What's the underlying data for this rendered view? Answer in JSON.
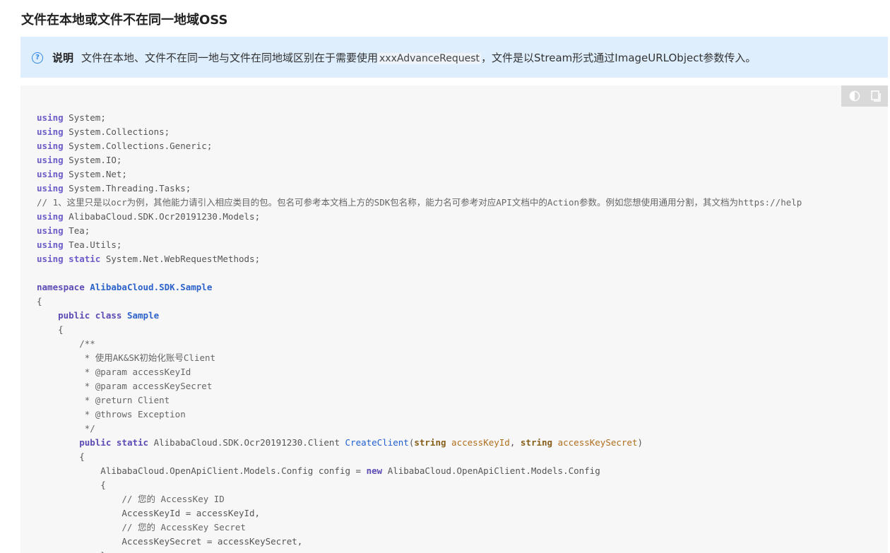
{
  "heading": "文件在本地或文件不在同一地域OSS",
  "note": {
    "icon": "question-circle-icon",
    "title": "说明",
    "text_before": "文件在本地、文件不在同一地与文件在同地域区别在于需要使用",
    "code": "xxxAdvanceRequest",
    "text_after": "，文件是以Stream形式通过ImageURLObject参数传入。"
  },
  "code_toolbar": {
    "theme_icon": "theme-toggle-icon",
    "copy_icon": "copy-icon"
  },
  "code": {
    "language": "csharp",
    "lines": [
      "using System;",
      "using System.Collections;",
      "using System.Collections.Generic;",
      "using System.IO;",
      "using System.Net;",
      "using System.Threading.Tasks;",
      "// 1、这里只是以ocr为例，其他能力请引入相应类目的包。包名可参考本文档上方的SDK包名称，能力名可参考对应API文档中的Action参数。例如您想使用通用分割，其文档为https://help",
      "using AlibabaCloud.SDK.Ocr20191230.Models;",
      "using Tea;",
      "using Tea.Utils;",
      "using static System.Net.WebRequestMethods;",
      "",
      "namespace AlibabaCloud.SDK.Sample",
      "{",
      "    public class Sample",
      "    {",
      "        /**",
      "         * 使用AK&SK初始化账号Client",
      "         * @param accessKeyId",
      "         * @param accessKeySecret",
      "         * @return Client",
      "         * @throws Exception",
      "         */",
      "        public static AlibabaCloud.SDK.Ocr20191230.Client CreateClient(string accessKeyId, string accessKeySecret)",
      "        {",
      "            AlibabaCloud.OpenApiClient.Models.Config config = new AlibabaCloud.OpenApiClient.Models.Config",
      "            {",
      "                // 您的 AccessKey ID",
      "                AccessKeyId = accessKeyId,",
      "                // 您的 AccessKey Secret",
      "                AccessKeySecret = accessKeySecret,",
      "            };"
    ]
  }
}
